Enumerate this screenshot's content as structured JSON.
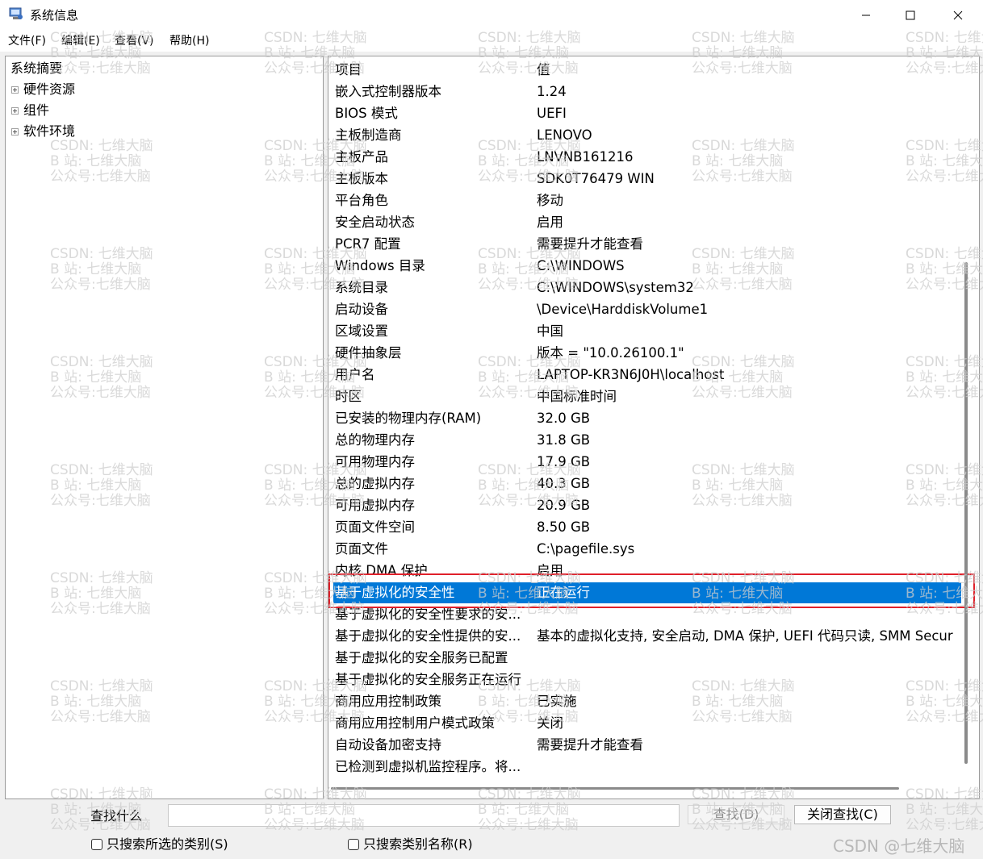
{
  "window": {
    "title": "系统信息",
    "controls": {
      "minimize": "minimize-icon",
      "maximize": "maximize-icon",
      "close": "close-icon"
    }
  },
  "menu": [
    "文件(F)",
    "编辑(E)",
    "查看(V)",
    "帮助(H)"
  ],
  "tree": {
    "root": "系统摘要",
    "nodes": [
      "硬件资源",
      "组件",
      "软件环境"
    ]
  },
  "table": {
    "headers": {
      "item": "项目",
      "value": "值"
    },
    "rows": [
      {
        "item": "嵌入式控制器版本",
        "value": "1.24"
      },
      {
        "item": "BIOS 模式",
        "value": "UEFI"
      },
      {
        "item": "主板制造商",
        "value": "LENOVO"
      },
      {
        "item": "主板产品",
        "value": "LNVNB161216"
      },
      {
        "item": "主板版本",
        "value": "SDK0T76479 WIN"
      },
      {
        "item": "平台角色",
        "value": "移动"
      },
      {
        "item": "安全启动状态",
        "value": "启用"
      },
      {
        "item": "PCR7 配置",
        "value": "需要提升才能查看"
      },
      {
        "item": "Windows 目录",
        "value": "C:\\WINDOWS"
      },
      {
        "item": "系统目录",
        "value": "C:\\WINDOWS\\system32"
      },
      {
        "item": "启动设备",
        "value": "\\Device\\HarddiskVolume1"
      },
      {
        "item": "区域设置",
        "value": "中国"
      },
      {
        "item": "硬件抽象层",
        "value": "版本 = \"10.0.26100.1\""
      },
      {
        "item": "用户名",
        "value": "LAPTOP-KR3N6J0H\\localhost"
      },
      {
        "item": "时区",
        "value": "中国标准时间"
      },
      {
        "item": "已安装的物理内存(RAM)",
        "value": "32.0 GB"
      },
      {
        "item": "总的物理内存",
        "value": "31.8 GB"
      },
      {
        "item": "可用物理内存",
        "value": "17.9 GB"
      },
      {
        "item": "总的虚拟内存",
        "value": "40.3 GB"
      },
      {
        "item": "可用虚拟内存",
        "value": "20.9 GB"
      },
      {
        "item": "页面文件空间",
        "value": "8.50 GB"
      },
      {
        "item": "页面文件",
        "value": "C:\\pagefile.sys"
      },
      {
        "item": "内核 DMA 保护",
        "value": "启用"
      },
      {
        "item": "基于虚拟化的安全性",
        "value": "正在运行",
        "selected": true
      },
      {
        "item": "基于虚拟化的安全性要求的安...",
        "value": ""
      },
      {
        "item": "基于虚拟化的安全性提供的安...",
        "value": "基本的虚拟化支持, 安全启动, DMA 保护, UEFI 代码只读, SMM Secur"
      },
      {
        "item": "基于虚拟化的安全服务已配置",
        "value": ""
      },
      {
        "item": "基于虚拟化的安全服务正在运行",
        "value": ""
      },
      {
        "item": "商用应用控制政策",
        "value": "已实施"
      },
      {
        "item": "商用应用控制用户模式政策",
        "value": "关闭"
      },
      {
        "item": "自动设备加密支持",
        "value": "需要提升才能查看"
      },
      {
        "item": "已检测到虚拟机监控程序。将...",
        "value": ""
      }
    ]
  },
  "search": {
    "label": "查找什么",
    "value": "",
    "find_button": "查找(D)",
    "close_find_button": "关闭查找(C)",
    "checkbox_selected_category": "只搜索所选的类别(S)",
    "checkbox_category_names": "只搜索类别名称(R)"
  },
  "watermark": {
    "lines": [
      "CSDN: 七维大脑",
      "B 站: 七维大脑",
      "公众号:七维大脑"
    ],
    "corner": "CSDN @七维大脑"
  },
  "colors": {
    "selection": "#0078d7",
    "highlight_box": "#e0202a"
  }
}
